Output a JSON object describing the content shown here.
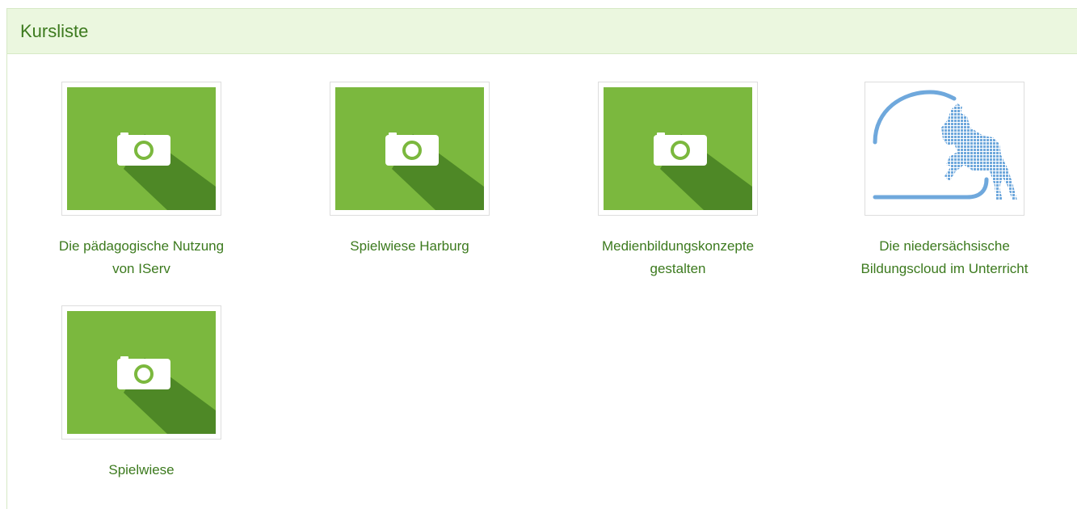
{
  "panel": {
    "title": "Kursliste"
  },
  "courses": [
    {
      "line1": "Die pädagogische Nutzung",
      "line2": "von IServ",
      "thumbnail": "camera-placeholder-icon"
    },
    {
      "line1": "Spielwiese Harburg",
      "line2": "",
      "thumbnail": "camera-placeholder-icon"
    },
    {
      "line1": "Medienbildungskonzepte",
      "line2": "gestalten",
      "thumbnail": "camera-placeholder-icon"
    },
    {
      "line1": "Die niedersächsische",
      "line2": "Bildungscloud im Unterricht",
      "thumbnail": "nbc-logo"
    },
    {
      "line1": "Spielwiese",
      "line2": "",
      "thumbnail": "camera-placeholder-icon"
    }
  ],
  "colors": {
    "accent_text": "#3c7a1e",
    "tile_green": "#7bb83e",
    "tile_shadow": "#4e8826",
    "heading_bg": "#ebf7df",
    "logo_blue": "#6fa8dc"
  }
}
